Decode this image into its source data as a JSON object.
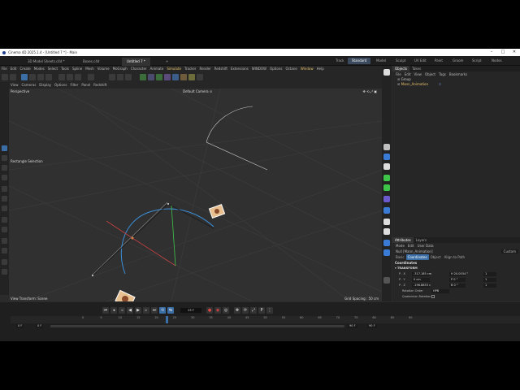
{
  "window": {
    "title": "Cinema 4D 2025.1.4 - [Untitled 7 *] - Main",
    "controls": [
      "–",
      "□",
      "✕"
    ]
  },
  "doc_tabs": [
    {
      "label": "3D Model Sheets.c4d *",
      "active": false
    },
    {
      "label": "Boxes.c4d",
      "active": false
    },
    {
      "label": "Untitled 7 *",
      "active": true
    },
    {
      "label": "+",
      "active": false
    }
  ],
  "layouts": [
    {
      "label": "Track",
      "active": false
    },
    {
      "label": "Standard",
      "active": true
    },
    {
      "label": "Model",
      "active": false
    },
    {
      "label": "Sculpt",
      "active": false
    },
    {
      "label": "UV Edit",
      "active": false
    },
    {
      "label": "Paint",
      "active": false
    },
    {
      "label": "Groom",
      "active": false
    },
    {
      "label": "Script",
      "active": false
    },
    {
      "label": "Nodes",
      "active": false
    }
  ],
  "menu": [
    "File",
    "Edit",
    "Create",
    "Modes",
    "Select",
    "Tools",
    "Spline",
    "Mesh",
    "Volume",
    "MoGraph",
    "Character",
    "Animate",
    "Simulate",
    "Tracker",
    "Render",
    "Redshift",
    "Extensions",
    "WINDOW",
    "Options",
    "Octane",
    "Window",
    "Help"
  ],
  "menu_highlight": [
    "Simulate",
    "Window"
  ],
  "viewport": {
    "menu": [
      "View",
      "Cameras",
      "Display",
      "Options",
      "Filter",
      "Panel",
      "Redshift"
    ],
    "name": "Perspective",
    "camera": "Default Camera ⊙",
    "tool": "Rectangle Selection",
    "transform_label": "View Transform: Scene",
    "grid_spacing": "Grid Spacing : 50 cm"
  },
  "objects_panel": {
    "tabs": [
      "Objects",
      "Takes"
    ],
    "menu": [
      "File",
      "Edit",
      "View",
      "Object",
      "Tags",
      "Bookmarks"
    ],
    "items": [
      {
        "name": "Group",
        "selected": false
      },
      {
        "name": "Mann_Animation",
        "selected": true
      }
    ]
  },
  "attributes": {
    "tabs": [
      "Attributes",
      "Layers"
    ],
    "menu": [
      "Mode",
      "Edit",
      "User Data"
    ],
    "object": "Null [Mann_Animation]",
    "preset": "Custom",
    "subtabs": [
      {
        "label": "Basic",
        "on": false
      },
      {
        "label": "Coordinates",
        "on": true
      },
      {
        "label": "Object",
        "on": false
      },
      {
        "label": "Align to Path",
        "on": false
      }
    ],
    "section": "Coordinates",
    "transform_header": "TRANSFORM",
    "rows": [
      {
        "axis": "P . X",
        "p": "-317.185 cm",
        "s": "1",
        "r": "H 20.0034 °"
      },
      {
        "axis": "P . Y",
        "p": "0 cm",
        "s": "1",
        "r": "P 0 °"
      },
      {
        "axis": "P . Z",
        "p": "-196.8853 c",
        "s": "1",
        "r": "B 0 °"
      }
    ],
    "rotation_order_label": "Rotation Order",
    "rotation_order": "HPB",
    "quaternion_label": "Quaternion Rotation",
    "freeze": "FREEZE TRANSFORM"
  },
  "timeline": {
    "current_frame": "23 F",
    "ticks": [
      "0",
      "5",
      "10",
      "15",
      "20",
      "25",
      "30",
      "35",
      "40",
      "45",
      "50",
      "55",
      "60",
      "65",
      "70",
      "75",
      "80",
      "85",
      "90"
    ],
    "start_frame": "0 F",
    "preview_start": "0 F",
    "preview_end": "90 F",
    "end_frame": "90 F",
    "playhead_frame": 23,
    "max_frame": 90
  },
  "colors": {
    "accent": "#3a6ea5",
    "highlight": "#e8c26a",
    "x_axis": "#e04545",
    "y_axis": "#3fc44a",
    "z_axis": "#3a7bd5"
  }
}
